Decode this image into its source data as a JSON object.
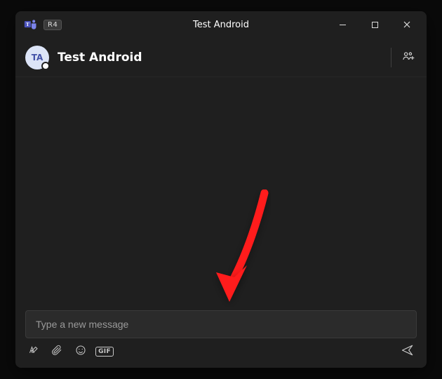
{
  "titlebar": {
    "title": "Test Android",
    "badge": "R4"
  },
  "header": {
    "chat_name": "Test Android",
    "avatar_initials": "TA"
  },
  "compose": {
    "placeholder": "Type a new message",
    "gif_label": "GIF"
  },
  "colors": {
    "arrow": "#ff1a1a",
    "accent": "#6264a7"
  }
}
